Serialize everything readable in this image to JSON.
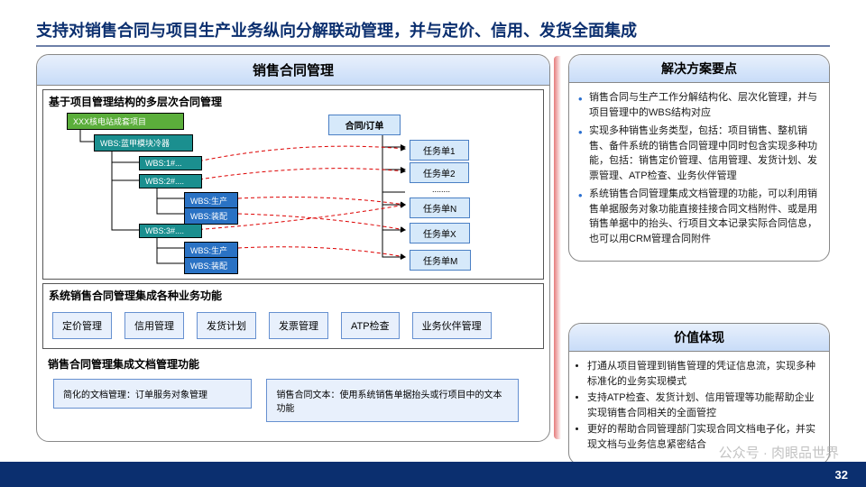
{
  "title": "支持对销售合同与项目生产业务纵向分解联动管理，并与定价、信用、发货全面集成",
  "leftPanel": {
    "title": "销售合同管理",
    "section1": {
      "title": "基于项目管理结构的多层次合同管理",
      "nodes": {
        "proj": "XXX核电站成套项目",
        "w1": "WBS:蓝甲模块冷器",
        "w2": "WBS:1#...",
        "w3": "WBS:2#....",
        "w4": "WBS:生产",
        "w5": "WBS:装配",
        "w6": "WBS:3#....",
        "w7": "WBS:生产",
        "w8": "WBS:装配",
        "contract": "合同/订单",
        "t1": "任务单1",
        "t2": "任务单2",
        "t3": "任务单N",
        "t4": "任务单X",
        "t5": "任务单M"
      }
    },
    "section2": {
      "title": "系统销售合同管理集成各种业务功能",
      "items": [
        "定价管理",
        "信用管理",
        "发货计划",
        "发票管理",
        "ATP检查",
        "业务伙伴管理"
      ]
    },
    "section3": {
      "title": "销售合同管理集成文档管理功能",
      "d1": "简化的文档管理：订单服务对象管理",
      "d2": "销售合同文本：使用系统销售单据抬头或行项目中的文本功能"
    }
  },
  "rightPanel": {
    "title": "解决方案要点",
    "items": [
      "销售合同与生产工作分解结构化、层次化管理，并与项目管理中的WBS结构对应",
      "实现多种销售业务类型，包括：项目销售、整机销售、备件系统的销售合同管理中同时包含实现多种功能，包括：销售定价管理、信用管理、发货计划、发票管理、ATP检查、业务伙伴管理",
      "系统销售合同管理集成文档管理的功能，可以利用销售单据服务对象功能直接挂接合同文档附件、或是用销售单据中的抬头、行项目文本记录实际合同信息，也可以用CRM管理合同附件"
    ]
  },
  "valuePanel": {
    "title": "价值体现",
    "items": [
      "打通从项目管理到销售管理的凭证信息流，实现多种标准化的业务实现模式",
      "支持ATP检查、发货计划、信用管理等功能帮助企业实现销售合同相关的全面管控",
      "更好的帮助合同管理部门实现合同文档电子化，并实现文档与业务信息紧密结合"
    ]
  },
  "pagenum": "32",
  "watermark": "公众号 · 肉眼品世界"
}
